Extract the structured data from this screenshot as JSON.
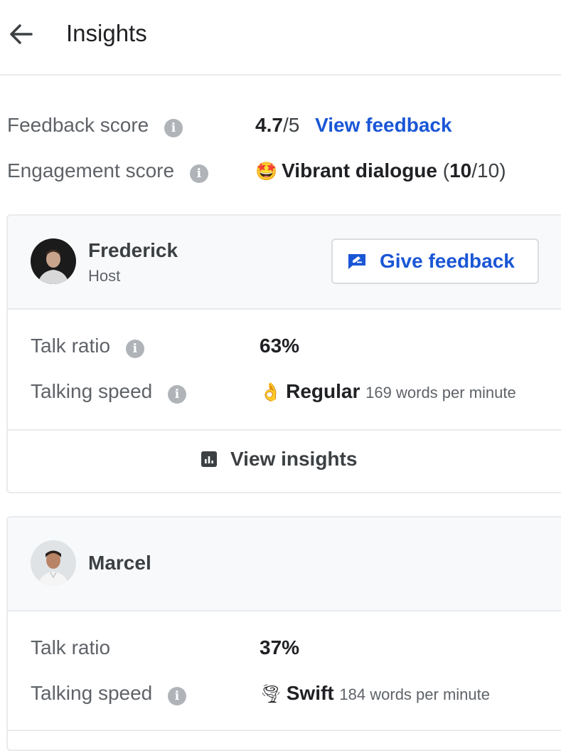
{
  "header": {
    "title": "Insights"
  },
  "scores": {
    "feedback": {
      "label": "Feedback score",
      "value": "4.7",
      "out_of": "/5",
      "link": "View feedback"
    },
    "engagement": {
      "label": "Engagement score",
      "emoji": "🤩",
      "value_text": "Vibrant dialogue",
      "paren_open": " (",
      "value": "10",
      "out_of": "/10)"
    }
  },
  "participants": [
    {
      "name": "Frederick",
      "role": "Host",
      "give_feedback_label": "Give feedback",
      "talk_ratio": {
        "label": "Talk ratio",
        "value": "63%"
      },
      "talking_speed": {
        "label": "Talking speed",
        "emoji": "👌",
        "value": "Regular",
        "detail": "169 words per minute"
      },
      "view_insights_label": "View insights"
    },
    {
      "name": "Marcel",
      "talk_ratio": {
        "label": "Talk ratio",
        "value": "37%"
      },
      "talking_speed": {
        "label": "Talking speed",
        "emoji": "🌪",
        "value": "Swift",
        "detail": "184 words per minute"
      }
    }
  ],
  "colors": {
    "link": "#1a56d6",
    "border": "#e8eaed",
    "header_bg": "#f8f9fa",
    "info_icon": "#b0b4b9"
  }
}
